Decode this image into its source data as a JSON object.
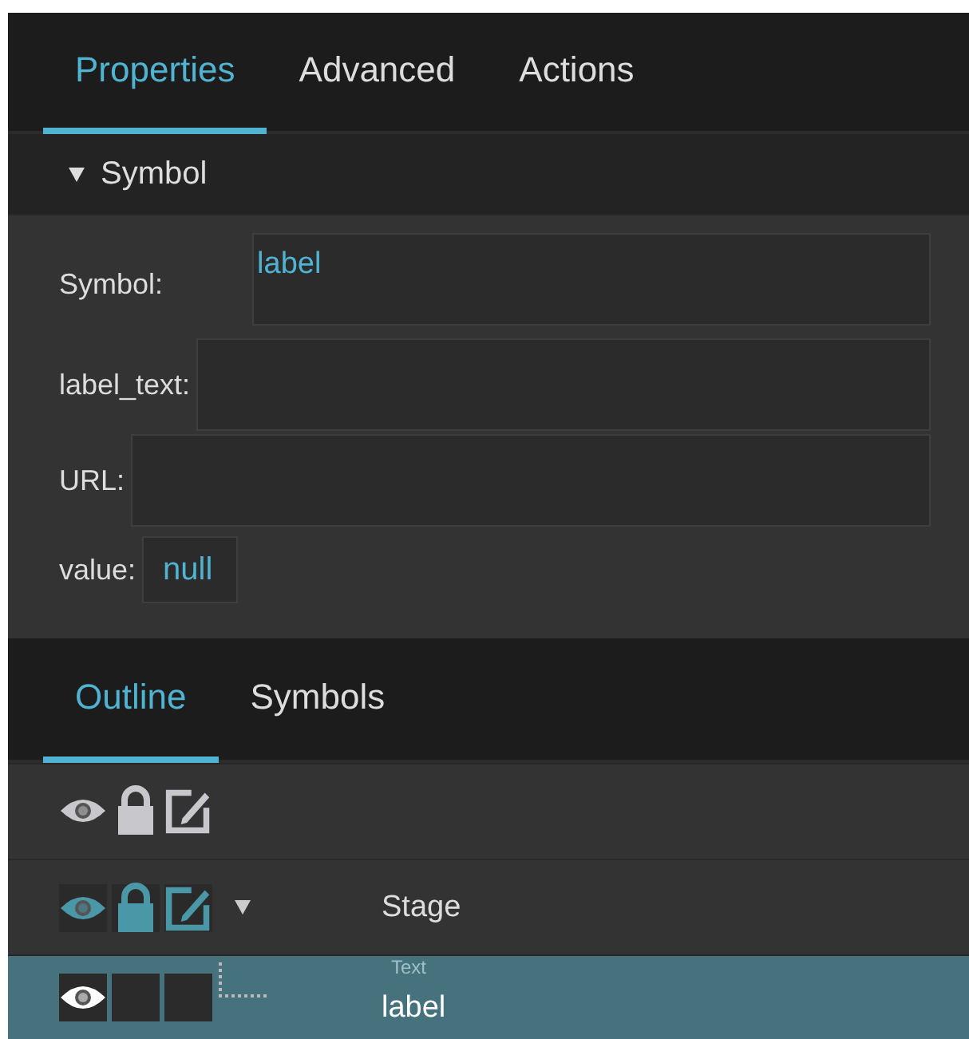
{
  "properties_tabs": [
    {
      "label": "Properties",
      "selected": true
    },
    {
      "label": "Advanced",
      "selected": false
    },
    {
      "label": "Actions",
      "selected": false
    }
  ],
  "section": {
    "title": "Symbol",
    "expanded": true
  },
  "fields": [
    {
      "label": "Symbol:",
      "value": "label",
      "kind": "wide"
    },
    {
      "label": "label_text:",
      "kind": "wide"
    },
    {
      "label": "URL:",
      "kind": "wide"
    },
    {
      "label": "value:",
      "value": "null",
      "kind": "small"
    }
  ],
  "outline_tabs": [
    {
      "label": "Outline",
      "selected": true
    },
    {
      "label": "Symbols",
      "selected": false
    }
  ],
  "outline": [
    {
      "kind": "header"
    },
    {
      "kind": "node",
      "name": "Stage",
      "selected": false,
      "expanded": true,
      "locked": true,
      "editable": true,
      "children": [
        {
          "kind": "node",
          "name": "label",
          "type": "Text",
          "selected": true,
          "locked": false,
          "editable": false
        }
      ]
    }
  ]
}
